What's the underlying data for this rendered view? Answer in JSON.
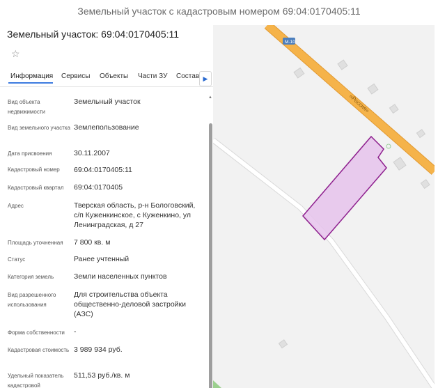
{
  "page_title": "Земельный участок с кадастровым номером 69:04:0170405:11",
  "card": {
    "title": "Земельный участок: 69:04:0170405:11",
    "favorite_icon": "star-outline-icon"
  },
  "tabs": [
    {
      "label": "Информация",
      "active": true
    },
    {
      "label": "Сервисы"
    },
    {
      "label": "Объекты"
    },
    {
      "label": "Части ЗУ"
    },
    {
      "label": "Состав"
    }
  ],
  "tabs_next_icon": "chevron-right-icon",
  "info_rows": [
    {
      "label": "Вид объекта недвижимости",
      "value": "Земельный участок"
    },
    {
      "label": "Вид земельного участка",
      "value": "Землепользование"
    },
    {
      "label": "Дата присвоения",
      "value": "30.11.2007"
    },
    {
      "label": "Кадастровый номер",
      "value": "69:04:0170405:11"
    },
    {
      "label": "Кадастровый квартал",
      "value": "69:04:0170405"
    },
    {
      "label": "Адрес",
      "value": "Тверская область, р-н Бологовский, с/п Куженкинское, с Куженкино, ул Ленинградская, д 27"
    },
    {
      "label": "Площадь уточненная",
      "value": "7 800 кв. м"
    },
    {
      "label": "Статус",
      "value": "Ранее учтенный"
    },
    {
      "label": "Категория земель",
      "value": "Земли населенных пунктов"
    },
    {
      "label": "Вид разрешенного использования",
      "value": "Для строительства объекта общественно-деловой застройки (АЗС)"
    },
    {
      "label": "Форма собственности",
      "value": "-"
    },
    {
      "label": "Кадастровая стоимость",
      "value": "3 989 934 руб."
    },
    {
      "label": "Удельный показатель кадастровой",
      "value": "511,53 руб./кв. м"
    }
  ],
  "map": {
    "road_badge": "М-10",
    "road_name": "«Россия»",
    "parcel_color": "#e6c3ec",
    "parcel_stroke": "#8e1f8e",
    "road_color": "#f5b34a"
  }
}
